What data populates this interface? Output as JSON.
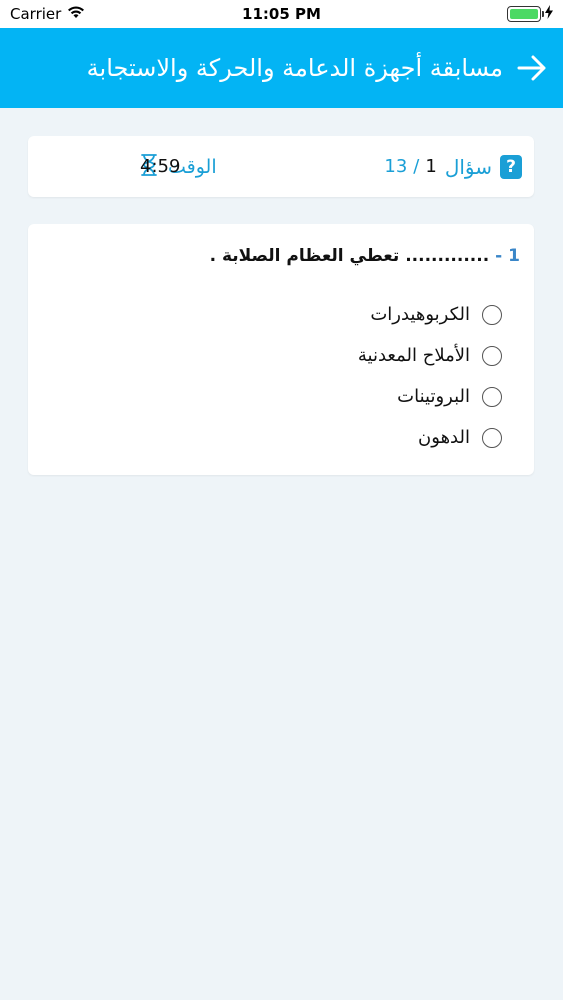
{
  "status_bar": {
    "carrier": "Carrier",
    "time": "11:05 PM"
  },
  "header": {
    "title": "مسابقة أجهزة الدعامة والحركة والاستجابة",
    "background": "#03b4f4",
    "back_icon": "arrow-right-icon"
  },
  "info": {
    "question_label": "سؤال",
    "current": "1",
    "separator": "/",
    "total": "13",
    "time_label": "الوقت",
    "time_value": "4:59",
    "accent": "#1a9fd6"
  },
  "question": {
    "number": "1 -",
    "text": "............. تعطي العظام الصلابة .",
    "options": [
      {
        "label": "الكربوهيدرات"
      },
      {
        "label": "الأملاح المعدنية"
      },
      {
        "label": "البروتينات"
      },
      {
        "label": "الدهون"
      }
    ]
  }
}
